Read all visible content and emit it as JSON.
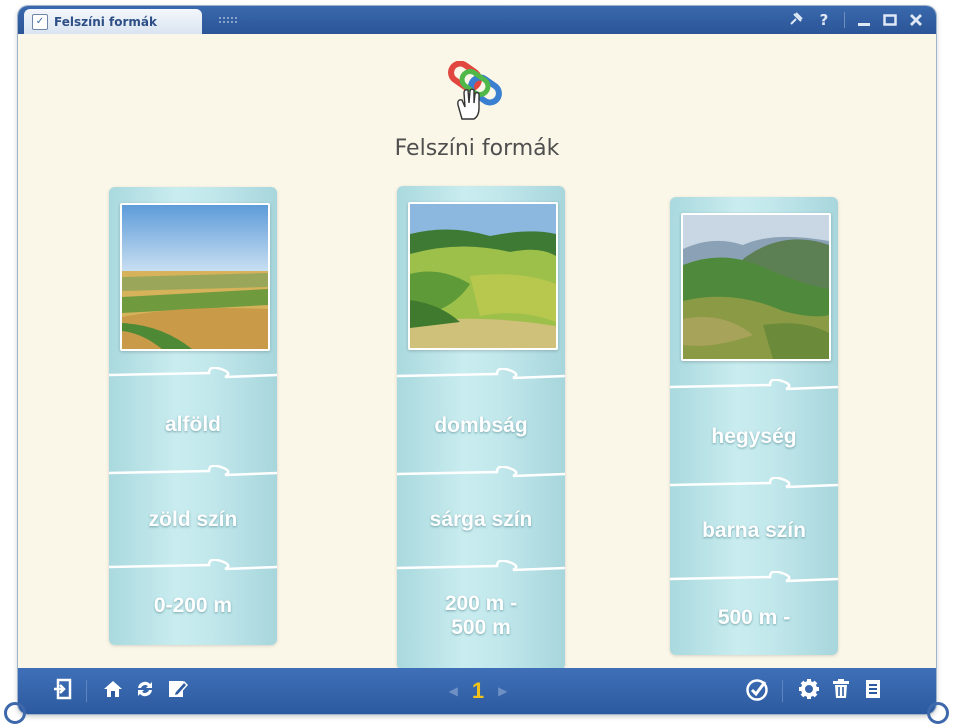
{
  "window": {
    "tab_title": "Felszíni formák",
    "controls": [
      "pin-icon",
      "help-icon",
      "minimize-icon",
      "maximize-icon",
      "close-icon"
    ]
  },
  "content": {
    "title": "Felszíni formák",
    "columns": [
      {
        "name": "alfold",
        "pieces": [
          "alföld",
          "zöld szín",
          "0-200 m"
        ]
      },
      {
        "name": "dombsag",
        "pieces": [
          "dombság",
          "sárga szín",
          "200 m -\n500 m"
        ]
      },
      {
        "name": "hegyseg",
        "pieces": [
          "hegység",
          "barna szín",
          "500 m -"
        ]
      }
    ]
  },
  "toolbar": {
    "left_icons": [
      "exit-icon",
      "home-icon",
      "refresh-icon",
      "edit-icon"
    ],
    "page_number": "1",
    "right_icons": [
      "check-icon",
      "settings-icon",
      "trash-icon",
      "list-icon"
    ]
  },
  "colors": {
    "chrome": "#2b5597",
    "background": "#faf6e8",
    "puzzle": "#bde6ea",
    "page_number": "#f2c21a"
  }
}
